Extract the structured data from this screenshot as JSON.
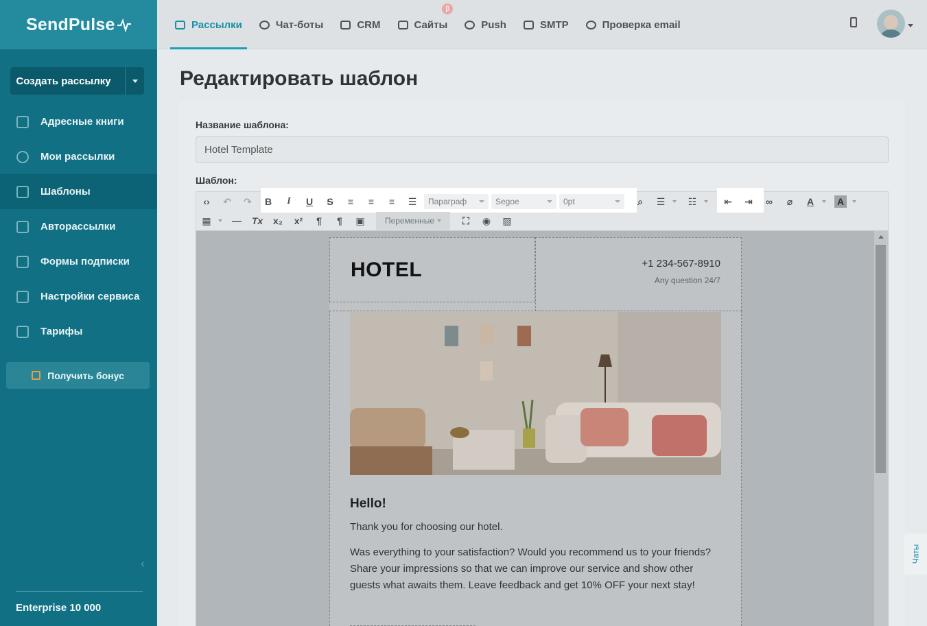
{
  "sidebar": {
    "logo": "SendPulse",
    "create_button": "Создать рассылку",
    "items": [
      {
        "label": "Адресные книги"
      },
      {
        "label": "Мои рассылки"
      },
      {
        "label": "Шаблоны"
      },
      {
        "label": "Авторассылки"
      },
      {
        "label": "Формы подписки"
      },
      {
        "label": "Настройки сервиса"
      },
      {
        "label": "Тарифы"
      }
    ],
    "active_item": "Шаблоны",
    "bonus_button": "Получить бонус",
    "plan": "Enterprise 10 000"
  },
  "topnav": {
    "tabs": [
      {
        "label": "Рассылки",
        "icon": "mail-icon"
      },
      {
        "label": "Чат-боты",
        "icon": "chat-icon"
      },
      {
        "label": "CRM",
        "icon": "crm-icon"
      },
      {
        "label": "Сайты",
        "icon": "sites-icon",
        "badge": "β"
      },
      {
        "label": "Push",
        "icon": "bell-icon"
      },
      {
        "label": "SMTP",
        "icon": "code-icon"
      },
      {
        "label": "Проверка email",
        "icon": "check-icon"
      }
    ],
    "active_tab": "Рассылки",
    "accent_color": "#1a9fb8"
  },
  "page": {
    "title": "Редактировать шаблон",
    "name_label": "Название шаблона:",
    "name_value": "Hotel Template",
    "template_label": "Шаблон:"
  },
  "toolbar": {
    "paragraph_select": "Параграф",
    "font_select": "Segoe",
    "size_select": "0pt",
    "variables_select": "Переменные"
  },
  "email": {
    "logo": "HOTEL",
    "phone": "+1 234-567-8910",
    "question": "Any question 24/7",
    "greeting": "Hello!",
    "line1": "Thank you for choosing our hotel.",
    "paragraph": "Was everything to your satisfaction? Would you recommend us to your friends? Share your impressions so that we can improve our service and show other guests what awaits them. Leave feedback and get 10% OFF your next stay!"
  },
  "chats_tab": "Чаты"
}
